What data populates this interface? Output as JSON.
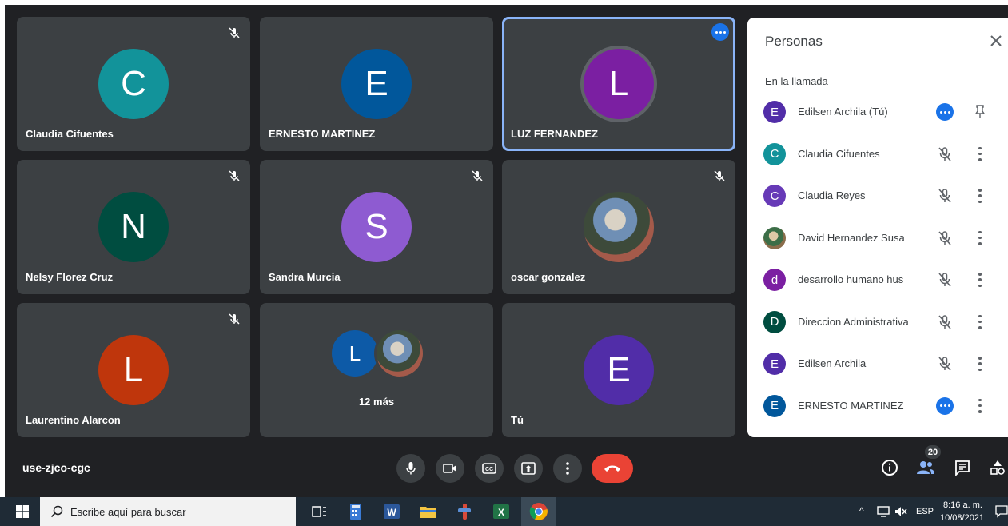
{
  "meeting_code": "use-zjco-cgc",
  "tiles": [
    {
      "name": "Claudia Cifuentes",
      "initial": "C",
      "color": "#12939a",
      "muted": true
    },
    {
      "name": "ERNESTO MARTINEZ",
      "initial": "E",
      "color": "#01579b",
      "muted": false
    },
    {
      "name": "LUZ FERNANDEZ",
      "initial": "L",
      "color": "#7b1fa2",
      "muted": false,
      "active": true
    },
    {
      "name": "Nelsy Florez Cruz",
      "initial": "N",
      "color": "#004d40",
      "muted": true
    },
    {
      "name": "Sandra Murcia",
      "initial": "S",
      "color": "#8e5bd1",
      "muted": true
    },
    {
      "name": "oscar gonzalez",
      "initial": "",
      "color": "#666666",
      "muted": true
    },
    {
      "name": "Laurentino Alarcon",
      "initial": "L",
      "color": "#bf360c",
      "muted": true
    },
    {
      "name": "",
      "initial": "L",
      "color": "#0d5aa7",
      "muted": false
    },
    {
      "name": "Tú",
      "initial": "E",
      "color": "#512da8",
      "muted": false
    }
  ],
  "more_tile": {
    "label": "12 más"
  },
  "people_panel": {
    "title": "Personas",
    "section_title": "En la llamada",
    "participants": [
      {
        "name": "Edilsen Archila (Tú)",
        "initial": "E",
        "color": "#512da8",
        "state": "speaking"
      },
      {
        "name": "Claudia Cifuentes",
        "initial": "C",
        "color": "#12939a",
        "state": "muted"
      },
      {
        "name": "Claudia Reyes",
        "initial": "C",
        "color": "#673ab7",
        "state": "muted"
      },
      {
        "name": "David Hernandez Susa",
        "initial": "",
        "color": "#5b8c5a",
        "state": "muted"
      },
      {
        "name": "desarrollo humano hus",
        "initial": "d",
        "color": "#7b1fa2",
        "state": "muted"
      },
      {
        "name": "Direccion Administrativa",
        "initial": "D",
        "color": "#004d40",
        "state": "muted"
      },
      {
        "name": "Edilsen Archila",
        "initial": "E",
        "color": "#512da8",
        "state": "muted"
      },
      {
        "name": "ERNESTO MARTINEZ",
        "initial": "E",
        "color": "#01579b",
        "state": "speaking"
      }
    ]
  },
  "participant_count": "20",
  "taskbar": {
    "search_placeholder": "Escribe aquí para buscar",
    "language": "ESP",
    "time": "8:16 a. m.",
    "date": "10/08/2021"
  }
}
